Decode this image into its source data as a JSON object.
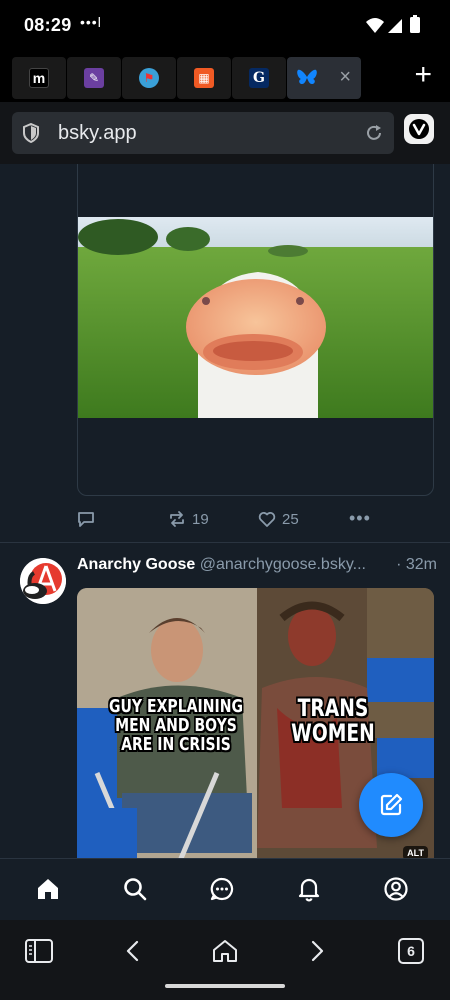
{
  "status_bar": {
    "time": "08:29",
    "dots": "•••l"
  },
  "tabs": [
    {
      "icon": "m",
      "name": "mastodon-tab"
    },
    {
      "icon": "✎",
      "name": "editor-tab"
    },
    {
      "icon": "⚑",
      "name": "antifa-tab"
    },
    {
      "icon": "▦",
      "name": "reader-tab"
    },
    {
      "icon": "G",
      "name": "guardian-tab"
    },
    {
      "icon": "butterfly",
      "name": "bluesky-tab"
    }
  ],
  "url_bar": {
    "url": "bsky.app"
  },
  "post1": {
    "reposts": "19",
    "likes": "25"
  },
  "post2": {
    "author_name": "Anarchy Goose",
    "author_handle": "@anarchygoose.bsky...",
    "time": "· 32m",
    "meme_left": "GUY EXPLAINING MEN AND BOYS ARE IN CRISIS",
    "meme_right": "TRANS WOMEN",
    "alt_badge": "ALT"
  },
  "browser_nav": {
    "tab_count": "6"
  },
  "colors": {
    "accent": "#208bfe",
    "background": "#161e27",
    "muted": "#8a9bab"
  }
}
